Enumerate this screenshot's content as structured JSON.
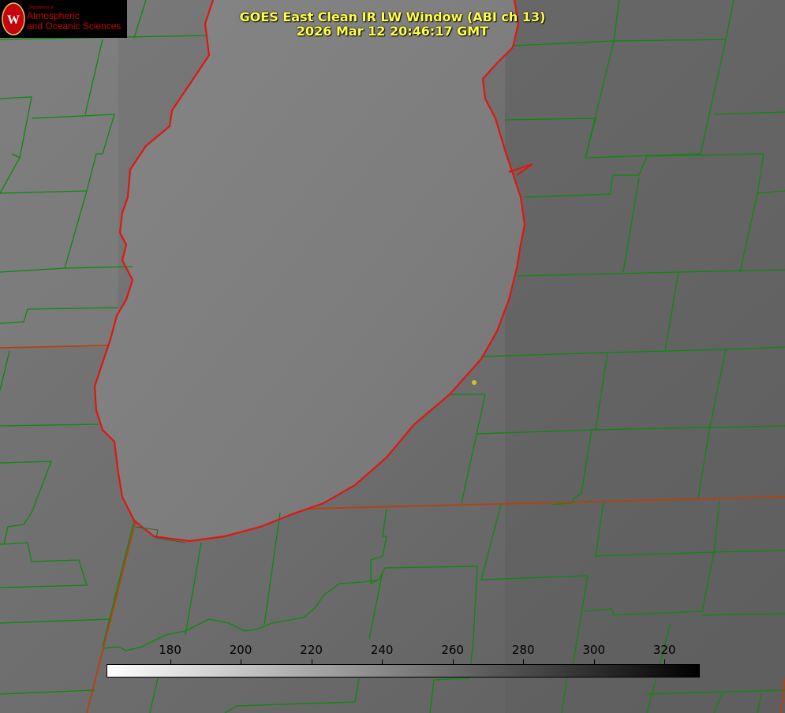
{
  "logo": {
    "small_text": "Department of",
    "line1": "Atmospheric",
    "line2": "and Oceanic Sciences"
  },
  "title": {
    "line1": "GOES East Clean IR LW Window (ABI ch 13)",
    "line2": "2026 Mar 12 20:46:17 GMT"
  },
  "colorbar": {
    "tick_labels": [
      "180",
      "200",
      "220",
      "240",
      "260",
      "280",
      "300",
      "320"
    ],
    "range_min": 162,
    "range_max": 330
  },
  "colors": {
    "county_lines": "#0b8a0b",
    "lake_outline": "#e0160e",
    "title_text": "#ffff44",
    "marker": "#d9c31a"
  }
}
